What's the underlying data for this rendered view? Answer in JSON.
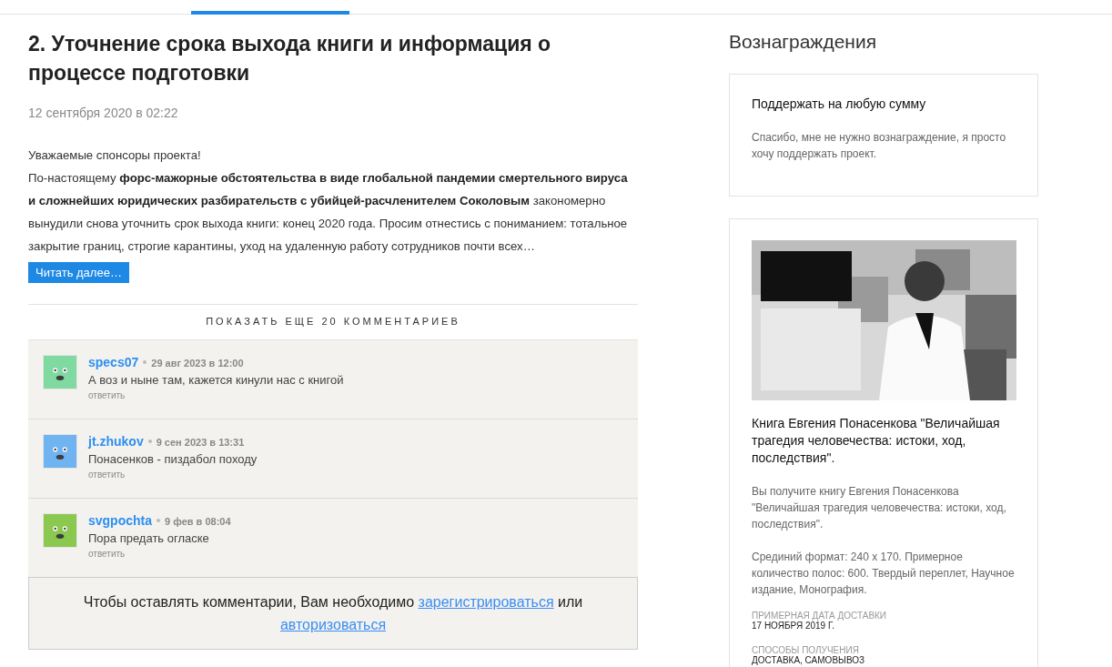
{
  "post": {
    "title": "2. Уточнение срока выхода книги и информация о процессе подготовки",
    "date": "12 сентября 2020 в 02:22",
    "greeting": "Уважаемые спонсоры проекта!",
    "body": "По-настоящему **форс-мажорные обстоятельства в виде глобальной пандемии смертельного вируса и сложнейших юридических разбирательств с убийцей-расчленителем Соколовым** закономерно вынудили снова уточнить срок выхода книги: конец 2020 года. Просим отнестись с пониманием: тотальное закрытие границ, строгие карантины, уход на удаленную работу сотрудников почти всех…",
    "read_more": "Читать далее…"
  },
  "comments": {
    "show_more": "ПОКАЗАТЬ ЕЩЕ 20 КОММЕНТАРИЕВ",
    "items": [
      {
        "author": "specs07",
        "time": "29 авг 2023 в 12:00",
        "text": "А воз и ныне там, кажется кинули нас с книгой",
        "reply": "ответить",
        "color": "#7fd9a0"
      },
      {
        "author": "jt.zhukov",
        "time": "9 сен 2023 в 13:31",
        "text": "Понасенков - пиздабол походу",
        "reply": "ответить",
        "color": "#6fb3f0"
      },
      {
        "author": "svgpochta",
        "time": "9 фев в 08:04",
        "text": "Пора предать огласке",
        "reply": "ответить",
        "color": "#8bc84f"
      }
    ],
    "login_prompt": {
      "text_before": "Чтобы оставлять комментарии, Вам необходимо",
      "register_link": "зарегистрироваться",
      "middle": "или",
      "login_link": "авторизоваться"
    }
  },
  "rewards": {
    "heading": "Вознаграждения",
    "cards": [
      {
        "title": "Поддержать на любую сумму",
        "paragraphs": [
          "Спасибо, мне не нужно вознаграждение, я просто хочу поддержать проект."
        ]
      },
      {
        "image": {
          "kind": "picture"
        },
        "title": "Книга Евгения Понасенкова \"Величайшая трагедия человечества: истоки, ход, последствия\".",
        "paragraphs": [
          "Вы получите книгу Евгения Понасенкова \"Величайшая трагедия человечества: истоки, ход, последствия\".",
          "Срединий формат: 240 х 170. Примерное количество полос: 600. Твердый переплет, Научное издание, Монография."
        ],
        "fields": [
          {
            "label": "ПРИМЕРНАЯ ДАТА ДОСТАВКИ",
            "value": "17 НОЯБРЯ 2019 Г."
          },
          {
            "label": "СПОСОБЫ ПОЛУЧЕНИЯ",
            "value": "ДОСТАВКА, САМОВЫВОЗ"
          }
        ]
      }
    ]
  }
}
